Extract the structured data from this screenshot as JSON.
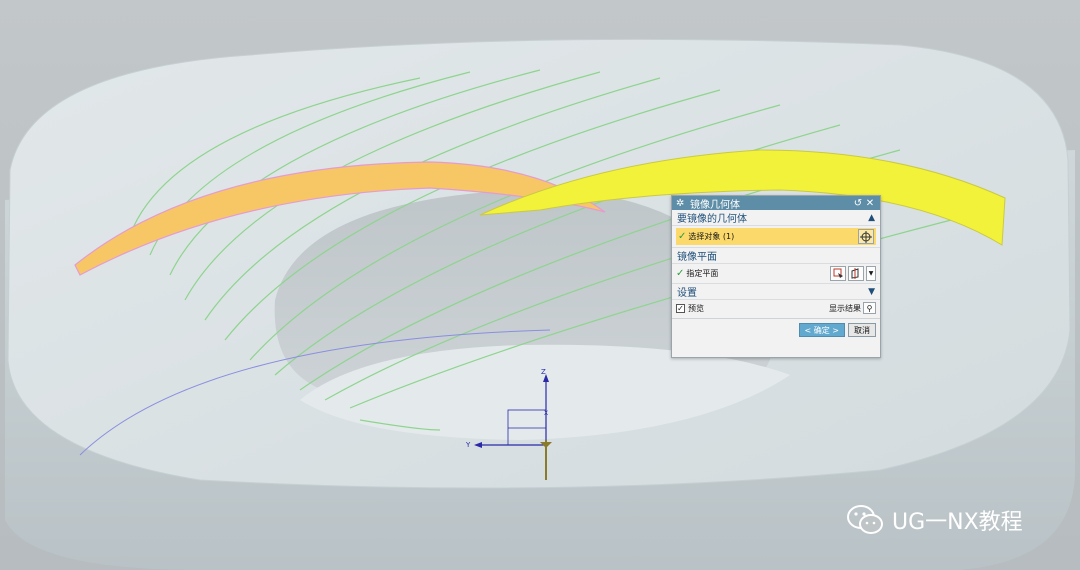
{
  "viewport": {
    "axes": {
      "z_label": "Z",
      "y_label": "Y",
      "x_label": "X"
    },
    "colors": {
      "background": "#bfc4c6",
      "part_body": "#d4dcdf",
      "orange_surface": "#f7c766",
      "yellow_surface": "#f2f23a",
      "guide_curves": "#8ed48e",
      "blue_curve": "#8a8ee0"
    }
  },
  "dialog": {
    "title": "镜像几何体",
    "section_geometry": {
      "label": "要镜像的几何体",
      "select_label": "选择对象 (1)"
    },
    "section_plane": {
      "label": "镜像平面",
      "specify_label": "指定平面"
    },
    "section_settings": {
      "label": "设置"
    },
    "preview_label": "预览",
    "show_result_label": "显示结果",
    "ok_label": "< 确定 >",
    "cancel_label": "取消"
  },
  "watermark": {
    "text": "UG一NX教程"
  }
}
